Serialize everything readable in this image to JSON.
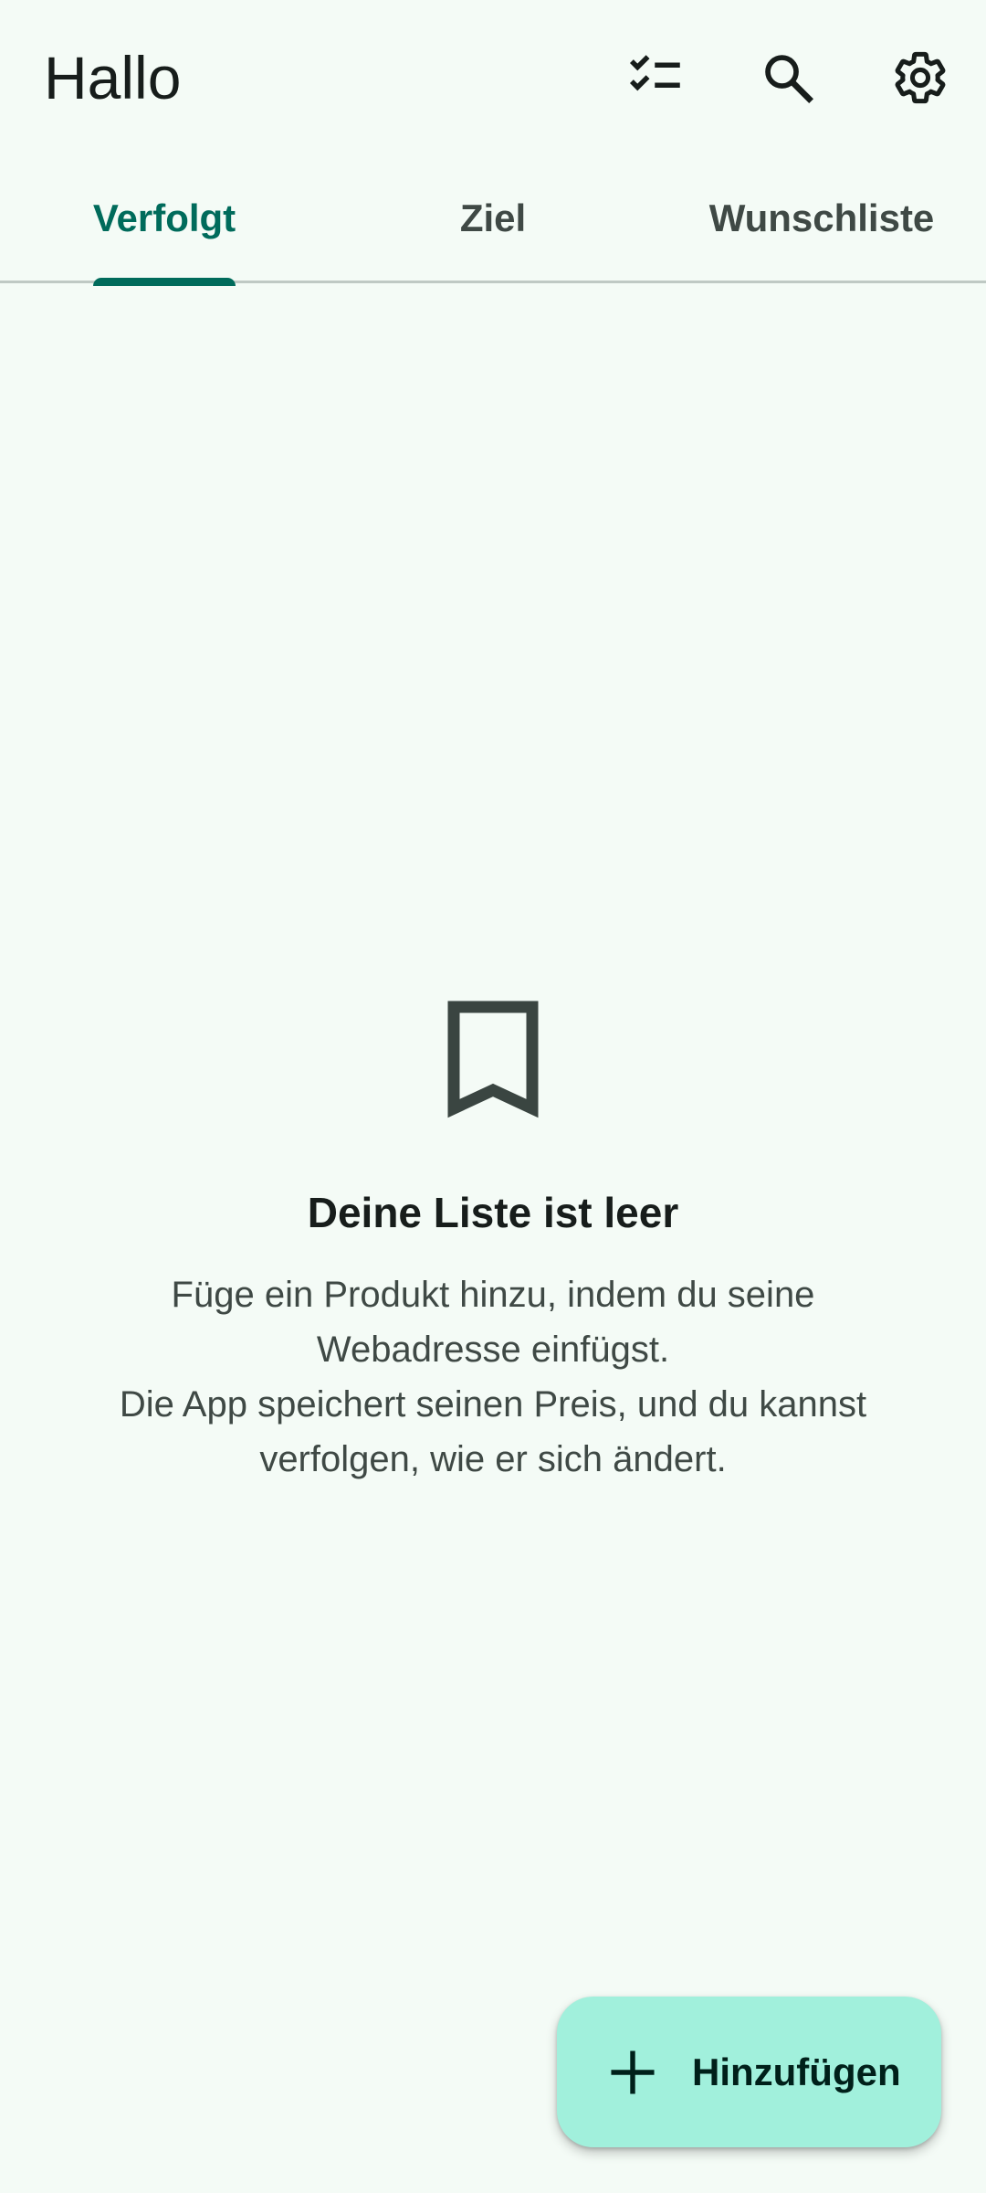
{
  "header": {
    "title": "Hallo",
    "actions": [
      {
        "icon": "checklist-icon"
      },
      {
        "icon": "search-icon"
      },
      {
        "icon": "settings-gear-icon"
      }
    ]
  },
  "tabs": [
    {
      "label": "Verfolgt",
      "active": true
    },
    {
      "label": "Ziel",
      "active": false
    },
    {
      "label": "Wunschliste",
      "active": false
    }
  ],
  "empty_state": {
    "icon": "bookmark-icon",
    "title": "Deine Liste ist leer",
    "line1": "Füge ein Produkt hinzu, indem du seine",
    "line2": "Webadresse einfügst.",
    "line3": "Die App speichert seinen Preis, und du kannst",
    "line4": "verfolgen, wie er sich ändert."
  },
  "fab": {
    "icon": "plus-icon",
    "label": "Hinzufügen"
  },
  "colors": {
    "background": "#F4FBF6",
    "accent": "#006B5B",
    "fab_background": "#A1F0DC",
    "divider": "#BFC9C4"
  }
}
